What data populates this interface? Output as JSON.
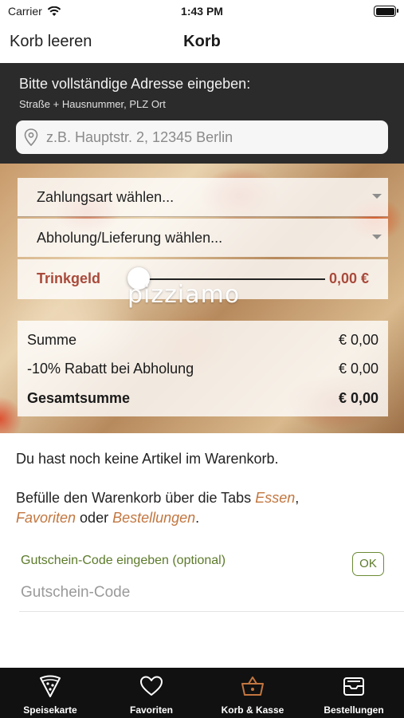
{
  "status": {
    "carrier": "Carrier",
    "time": "1:43 PM"
  },
  "nav": {
    "left_action": "Korb leeren",
    "title": "Korb"
  },
  "address": {
    "heading": "Bitte vollständige Adresse eingeben:",
    "subheading": "Straße + Hausnummer, PLZ Ort",
    "placeholder": "z.B. Hauptstr. 2, 12345 Berlin"
  },
  "options": {
    "payment_label": "Zahlungsart wählen...",
    "delivery_label": "Abholung/Lieferung wählen..."
  },
  "tip": {
    "label": "Trinkgeld",
    "value": "0,00 €",
    "slider_fraction": 0.0
  },
  "logo_text": "pizziamo",
  "summary": [
    {
      "label": "Summe",
      "value": "€ 0,00",
      "bold": false
    },
    {
      "label": "-10% Rabatt bei Abholung",
      "value": "€ 0,00",
      "bold": false
    },
    {
      "label": "Gesamtsumme",
      "value": "€ 0,00",
      "bold": true
    }
  ],
  "empty_message": "Du hast noch keine Artikel im Warenkorb.",
  "fill_hint": {
    "prefix": "Befülle den Warenkorb über die Tabs ",
    "link1": "Essen",
    "sep1": ",",
    "link2": "Favoriten",
    "sep2": " oder ",
    "link3": "Bestellungen",
    "suffix": "."
  },
  "voucher": {
    "label": "Gutschein-Code eingeben (optional)",
    "ok": "OK",
    "placeholder": "Gutschein-Code"
  },
  "tabs": [
    {
      "label": "Speisekarte",
      "icon": "pizza-slice-icon"
    },
    {
      "label": "Favoriten",
      "icon": "heart-icon"
    },
    {
      "label": "Korb & Kasse",
      "icon": "basket-icon",
      "active": true
    },
    {
      "label": "Bestellungen",
      "icon": "tray-icon"
    }
  ],
  "colors": {
    "accent": "#c2763f",
    "tip_red": "#a94a3b",
    "voucher_green": "#5c7a2a",
    "tabbar": "#111111"
  }
}
